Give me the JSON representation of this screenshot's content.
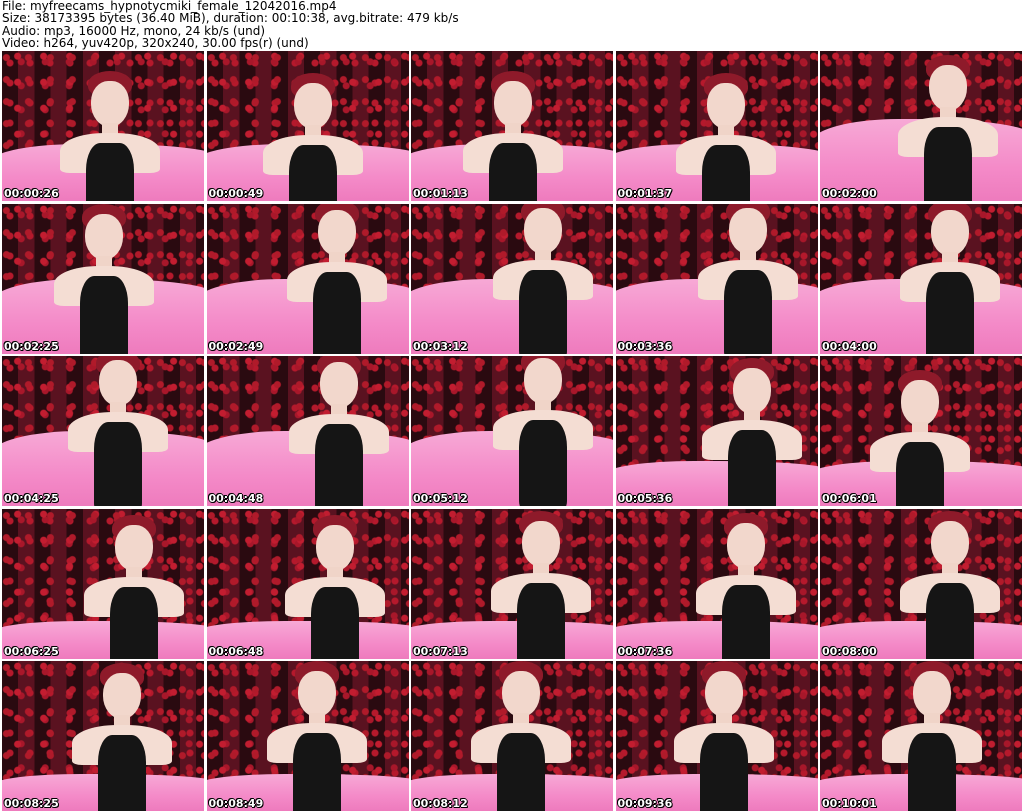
{
  "header": {
    "file": "File: myfreecams_hypnotycmiki_female_12042016.mp4",
    "size": "Size: 38173395 bytes (36.40 MiB), duration: 00:10:38, avg.bitrate: 479 kb/s",
    "audio": "Audio: mp3, 16000 Hz, mono, 24 kb/s (und)",
    "video": "Video: h264, yuv420p, 320x240, 30.00 fps(r) (und)"
  },
  "thumbnails": [
    {
      "timestamp": "00:00:26"
    },
    {
      "timestamp": "00:00:49"
    },
    {
      "timestamp": "00:01:13"
    },
    {
      "timestamp": "00:01:37"
    },
    {
      "timestamp": "00:02:00"
    },
    {
      "timestamp": "00:02:25"
    },
    {
      "timestamp": "00:02:49"
    },
    {
      "timestamp": "00:03:12"
    },
    {
      "timestamp": "00:03:36"
    },
    {
      "timestamp": "00:04:00"
    },
    {
      "timestamp": "00:04:25"
    },
    {
      "timestamp": "00:04:48"
    },
    {
      "timestamp": "00:05:12"
    },
    {
      "timestamp": "00:05:36"
    },
    {
      "timestamp": "00:06:01"
    },
    {
      "timestamp": "00:06:25"
    },
    {
      "timestamp": "00:06:48"
    },
    {
      "timestamp": "00:07:13"
    },
    {
      "timestamp": "00:07:36"
    },
    {
      "timestamp": "00:08:00"
    },
    {
      "timestamp": "00:08:25"
    },
    {
      "timestamp": "00:08:49"
    },
    {
      "timestamp": "00:08:12"
    },
    {
      "timestamp": "00:09:36"
    },
    {
      "timestamp": "00:10:01"
    }
  ]
}
